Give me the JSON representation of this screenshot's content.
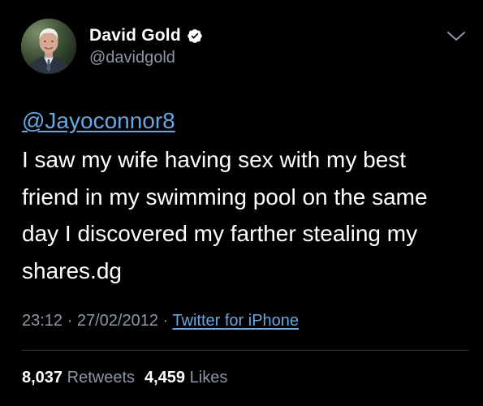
{
  "user": {
    "display_name": "David Gold",
    "handle": "@davidgold",
    "verified": true
  },
  "icons": {
    "verified": "verified-badge-icon",
    "menu": "chevron-down-icon"
  },
  "tweet": {
    "reply_to": "@Jayoconnor8",
    "lines": [
      "I saw my wife having sex with my best",
      "friend in my swimming pool on the same",
      "day I discovered my farther stealing my",
      "shares.dg"
    ]
  },
  "meta": {
    "time": "23:12",
    "separator": "·",
    "date": "27/02/2012",
    "source": "Twitter for iPhone"
  },
  "stats": {
    "retweets_count": "8,037",
    "retweets_label": "Retweets",
    "likes_count": "4,459",
    "likes_label": "Likes"
  },
  "colors": {
    "background": "#000000",
    "link": "#6aa6e0",
    "secondary_text": "#8b98a5",
    "verified_badge": "#ffffff"
  }
}
